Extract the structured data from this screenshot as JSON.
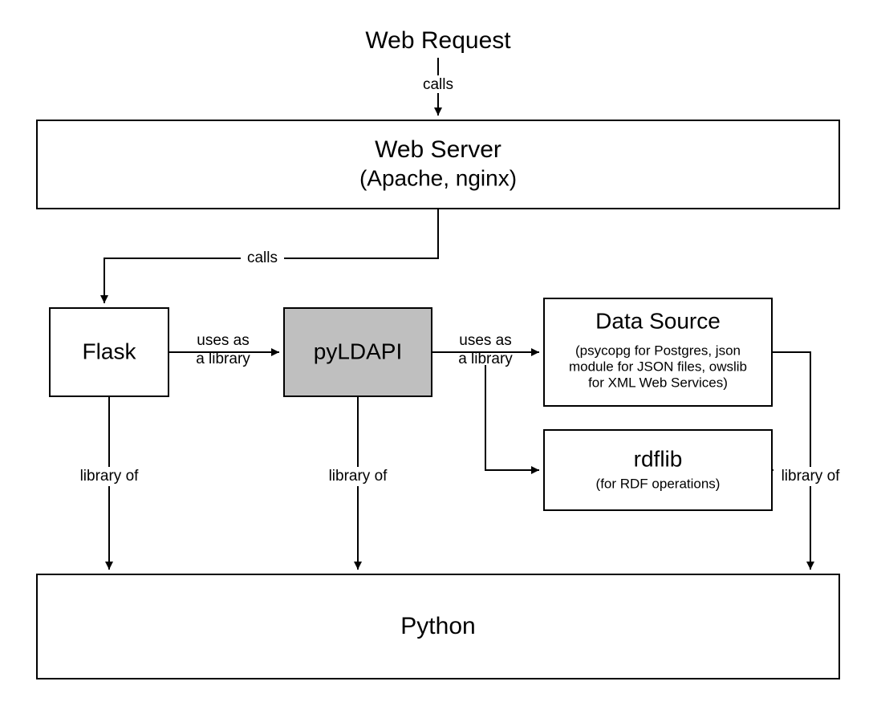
{
  "nodes": {
    "web_request": {
      "title": "Web Request"
    },
    "web_server": {
      "title": "Web Server",
      "subtitle": "(Apache, nginx)"
    },
    "flask": {
      "title": "Flask"
    },
    "pyldapi": {
      "title": "pyLDAPI"
    },
    "data_source": {
      "title": "Data Source",
      "sub1": "(psycopg for Postgres, json",
      "sub2": "module for JSON files, owslib",
      "sub3": "for XML Web Services)"
    },
    "rdflib": {
      "title": "rdflib",
      "subtitle": "(for RDF operations)"
    },
    "python": {
      "title": "Python"
    }
  },
  "edges": {
    "calls1": "calls",
    "calls2": "calls",
    "uses1a": "uses as",
    "uses1b": "a library",
    "uses2a": "uses as",
    "uses2b": "a library",
    "lib1": "library of",
    "lib2": "library of",
    "lib3": "library of"
  },
  "meta": {
    "diagram_type": "architecture-flow",
    "highlight_color": "#bfbfbf",
    "box_stroke": "#000000",
    "background": "#ffffff"
  }
}
